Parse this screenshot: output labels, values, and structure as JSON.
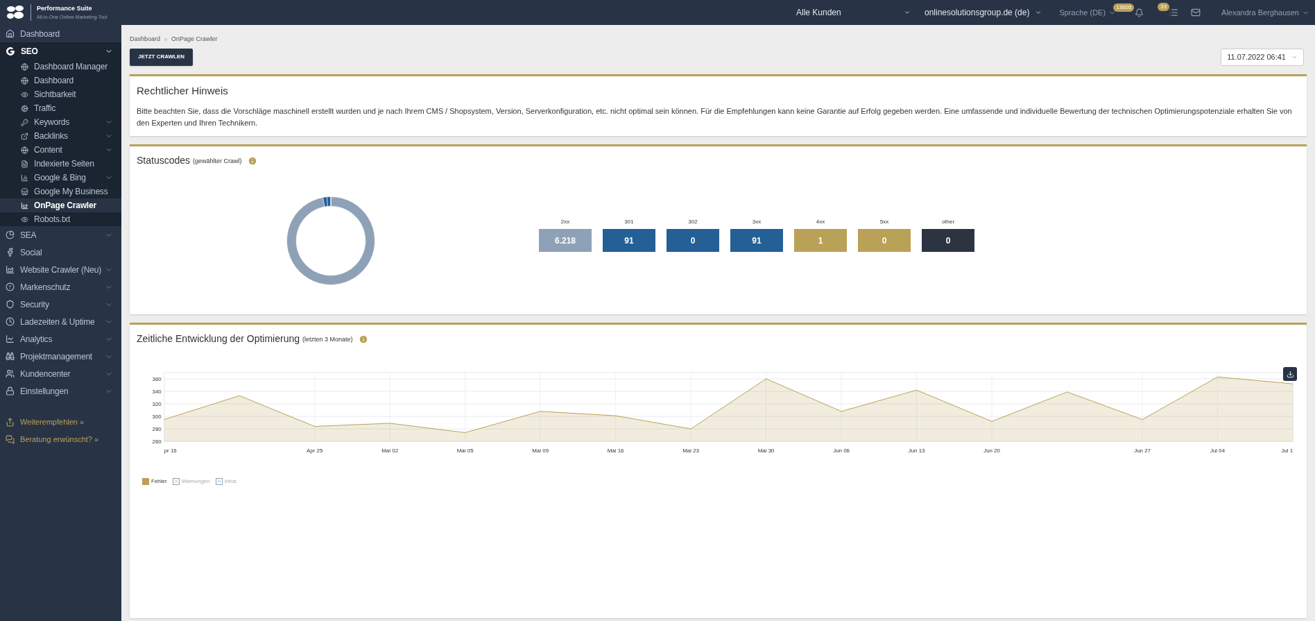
{
  "brand": {
    "title": "Performance Suite",
    "tagline": "All-in-One Online-Marketing-Tool"
  },
  "topbar": {
    "customer_select": "Alle Kunden",
    "domain_select": "onlinesolutionsgroup.de (de)",
    "language": "Sprache (DE)",
    "notifications": "13605",
    "tasks": "33",
    "user": "Alexandra Berghausen"
  },
  "sidebar": {
    "items": [
      {
        "kind": "home",
        "label": "Dashboard",
        "has_submenu": false,
        "selected": false
      },
      {
        "kind": "google",
        "label": "SEO",
        "has_submenu": true,
        "selected": true,
        "expanded": true,
        "children": [
          {
            "kind": "globe",
            "label": "Dashboard Manager",
            "has_submenu": false,
            "selected": false
          },
          {
            "kind": "globe",
            "label": "Dashboard",
            "has_submenu": false,
            "selected": false
          },
          {
            "kind": "eye",
            "label": "Sichtbarkeit",
            "has_submenu": false,
            "selected": false
          },
          {
            "kind": "cogs",
            "label": "Traffic",
            "has_submenu": false,
            "selected": false
          },
          {
            "kind": "key",
            "label": "Keywords",
            "has_submenu": true,
            "selected": false
          },
          {
            "kind": "link",
            "label": "Backlinks",
            "has_submenu": true,
            "selected": false
          },
          {
            "kind": "globe",
            "label": "Content",
            "has_submenu": true,
            "selected": false
          },
          {
            "kind": "file",
            "label": "Indexierte Seiten",
            "has_submenu": false,
            "selected": false
          },
          {
            "kind": "chart",
            "label": "Google & Bing",
            "has_submenu": true,
            "selected": false
          },
          {
            "kind": "store",
            "label": "Google My Business",
            "has_submenu": false,
            "selected": false
          },
          {
            "kind": "area",
            "label": "OnPage Crawler",
            "has_submenu": false,
            "selected": true
          },
          {
            "kind": "eye",
            "label": "Robots.txt",
            "has_submenu": false,
            "selected": false
          }
        ]
      },
      {
        "kind": "pie",
        "label": "SEA",
        "has_submenu": true,
        "selected": false
      },
      {
        "kind": "facebook",
        "label": "Social",
        "has_submenu": false,
        "selected": false
      },
      {
        "kind": "area",
        "label": "Website Crawler (Neu)",
        "has_submenu": true,
        "selected": false
      },
      {
        "kind": "alert",
        "label": "Markenschutz",
        "has_submenu": true,
        "selected": false
      },
      {
        "kind": "shield",
        "label": "Security",
        "has_submenu": true,
        "selected": false
      },
      {
        "kind": "clock",
        "label": "Ladezeiten & Uptime",
        "has_submenu": true,
        "selected": false
      },
      {
        "kind": "line",
        "label": "Analytics",
        "has_submenu": true,
        "selected": false
      },
      {
        "kind": "binoculars",
        "label": "Projektmanagement",
        "has_submenu": true,
        "selected": false
      },
      {
        "kind": "users",
        "label": "Kundencenter",
        "has_submenu": true,
        "selected": false
      },
      {
        "kind": "lock",
        "label": "Einstellungen",
        "has_submenu": true,
        "selected": false
      }
    ],
    "footer_links": [
      {
        "kind": "share",
        "label": "Weiterempfehlen »"
      },
      {
        "kind": "chat",
        "label": "Beratung erwünscht? »"
      }
    ]
  },
  "breadcrumb": [
    "Dashboard",
    "OnPage Crawler"
  ],
  "crawl_button": "JETZT CRAWLEN",
  "date_select": "11.07.2022 06:41",
  "notice": {
    "title": "Rechtlicher Hinweis",
    "text": "Bitte beachten Sie, dass die Vorschläge maschinell erstellt wurden und je nach Ihrem CMS / Shopsystem, Version, Serverkonfiguration, etc. nicht optimal sein können. Für die Empfehlungen kann keine Garantie auf Erfolg gegeben werden. Eine umfassende und individuelle Bewertung der technischen Optimierungspotenziale erhalten Sie von den Experten und Ihren Technikern."
  },
  "statuscodes": {
    "title": "Statuscodes",
    "subtitle": "(gewählter Crawl)",
    "codes": [
      {
        "label": "2xx",
        "value": "6.218",
        "color": "#8fa1b6"
      },
      {
        "label": "301",
        "value": "91",
        "color": "#245f96"
      },
      {
        "label": "302",
        "value": "0",
        "color": "#245f96"
      },
      {
        "label": "3xx",
        "value": "91",
        "color": "#245f96"
      },
      {
        "label": "4xx",
        "value": "1",
        "color": "#b9a157"
      },
      {
        "label": "5xx",
        "value": "0",
        "color": "#b9a157"
      },
      {
        "label": "other",
        "value": "0",
        "color": "#2c3441"
      }
    ]
  },
  "development": {
    "title": "Zeitliche Entwicklung der Optimierung",
    "subtitle": "(letzten 3 Monate)",
    "chart_data": {
      "type": "area",
      "categories": [
        "pr 16",
        null,
        "Apr 25",
        "Mai 02",
        "Mai 05",
        "Mai 09",
        "Mai 16",
        "Mai 23",
        "Mai 30",
        "Jun 06",
        "Jun 13",
        "Jun 20",
        null,
        "Jun 27",
        "Jul 04",
        "Jul 1"
      ],
      "series": [
        {
          "name": "Fehler",
          "color": "#b9a157",
          "values": [
            295,
            333,
            284,
            289,
            274,
            308,
            301,
            280,
            360,
            308,
            342,
            292,
            339,
            295,
            363,
            352
          ]
        }
      ],
      "ylim": [
        260,
        370
      ],
      "yticks": [
        260,
        280,
        300,
        320,
        340,
        360
      ],
      "grid": true
    },
    "hidden_series": [
      {
        "label": "Warnungen"
      },
      {
        "label": "Infos"
      }
    ]
  }
}
